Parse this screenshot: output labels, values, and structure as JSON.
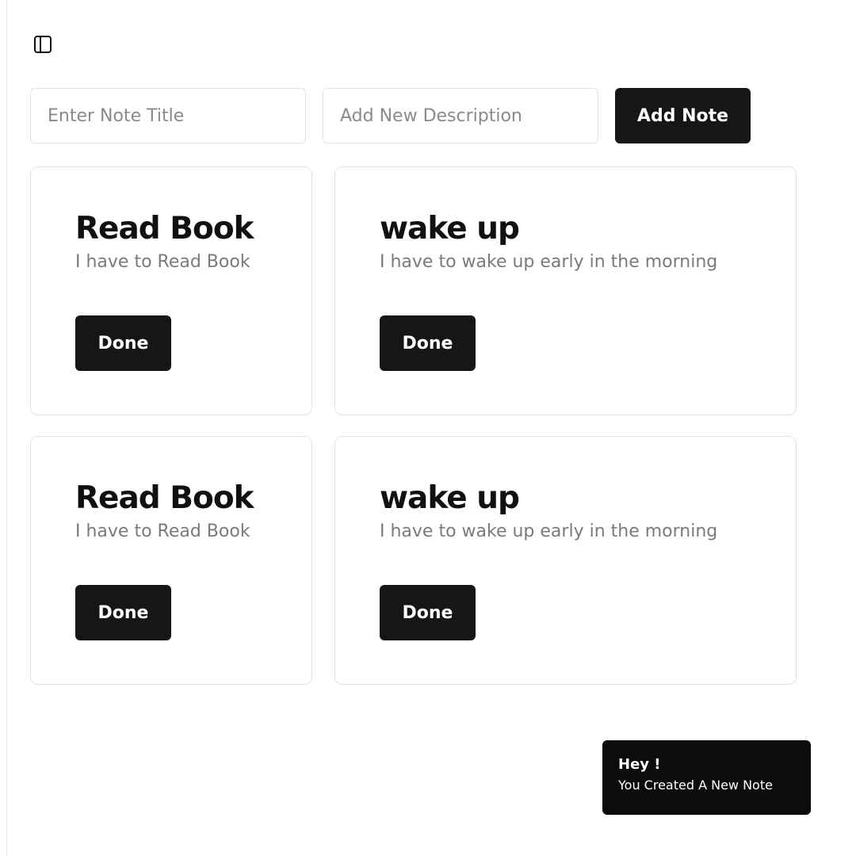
{
  "toolbar": {
    "sidebar_toggle_icon": "sidebar-toggle-icon"
  },
  "form": {
    "title_placeholder": "Enter Note Title",
    "title_value": "",
    "description_placeholder": "Add New Description",
    "description_value": "",
    "add_label": "Add Note"
  },
  "notes": [
    {
      "title": "Read Book",
      "description": "I have to Read Book",
      "done_label": "Done"
    },
    {
      "title": "wake up",
      "description": "I have to wake up early in the morning",
      "done_label": "Done"
    },
    {
      "title": "Read Book",
      "description": "I have to Read Book",
      "done_label": "Done"
    },
    {
      "title": "wake up",
      "description": "I have to wake up early in the morning",
      "done_label": "Done"
    }
  ],
  "toast": {
    "title": "Hey !",
    "message": "You Created A New Note"
  },
  "colors": {
    "button_bg": "#161616",
    "toast_bg": "#0c0c0c",
    "border": "#e2e2e2",
    "muted_text": "#7a7a7a"
  }
}
